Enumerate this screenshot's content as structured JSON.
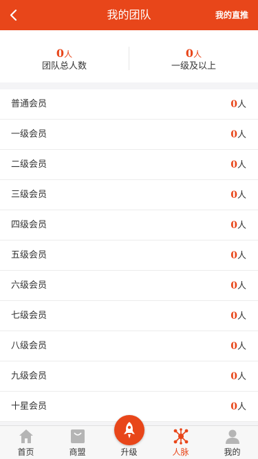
{
  "header": {
    "title": "我的团队",
    "right_link": "我的直推"
  },
  "stats": {
    "total": {
      "value": "0",
      "unit": "人",
      "label": "团队总人数"
    },
    "level1_plus": {
      "value": "0",
      "unit": "人",
      "label": "一级及以上"
    }
  },
  "members": [
    {
      "name": "普通会员",
      "count": "0",
      "unit": "人"
    },
    {
      "name": "一级会员",
      "count": "0",
      "unit": "人"
    },
    {
      "name": "二级会员",
      "count": "0",
      "unit": "人"
    },
    {
      "name": "三级会员",
      "count": "0",
      "unit": "人"
    },
    {
      "name": "四级会员",
      "count": "0",
      "unit": "人"
    },
    {
      "name": "五级会员",
      "count": "0",
      "unit": "人"
    },
    {
      "name": "六级会员",
      "count": "0",
      "unit": "人"
    },
    {
      "name": "七级会员",
      "count": "0",
      "unit": "人"
    },
    {
      "name": "八级会员",
      "count": "0",
      "unit": "人"
    },
    {
      "name": "九级会员",
      "count": "0",
      "unit": "人"
    },
    {
      "name": "十星会员",
      "count": "0",
      "unit": "人"
    }
  ],
  "tabbar": {
    "home": "首页",
    "alliance": "商盟",
    "upgrade": "升级",
    "network": "人脉",
    "mine": "我的",
    "active": "人脉"
  },
  "colors": {
    "accent": "#e8461a",
    "icon_gray": "#b5b5b5"
  },
  "icons": {
    "back": "chevron-left-icon",
    "home": "house-icon",
    "alliance": "shop-bag-icon",
    "upgrade": "rocket-icon",
    "network": "network-nodes-icon",
    "mine": "user-icon"
  }
}
